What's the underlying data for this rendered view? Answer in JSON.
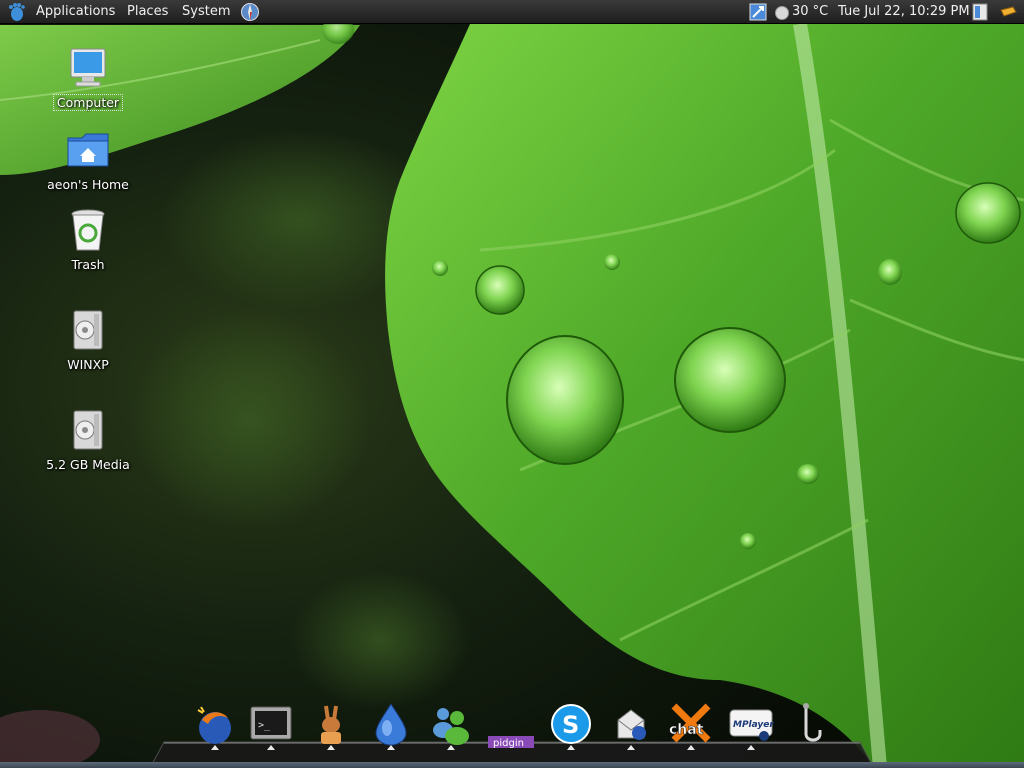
{
  "top_panel": {
    "menus": [
      "Applications",
      "Places",
      "System"
    ],
    "temperature": "30 °C",
    "datetime": "Tue Jul 22, 10:29 PM"
  },
  "desktop_icons": [
    {
      "label": "Computer",
      "icon": "computer-icon"
    },
    {
      "label": "aeon's Home",
      "icon": "home-folder-icon"
    },
    {
      "label": "Trash",
      "icon": "trash-icon"
    },
    {
      "label": "WINXP",
      "icon": "drive-icon"
    },
    {
      "label": "5.2 GB Media",
      "icon": "drive-icon"
    }
  ],
  "dock": {
    "items": [
      {
        "name": "firefox-icon"
      },
      {
        "name": "terminal-icon"
      },
      {
        "name": "amule-icon"
      },
      {
        "name": "deluge-icon"
      },
      {
        "name": "messenger-icon"
      },
      {
        "name": "pidgin-icon",
        "text": "pidgin"
      },
      {
        "name": "skype-icon"
      },
      {
        "name": "email-icon"
      },
      {
        "name": "xchat-icon",
        "text": "chat"
      },
      {
        "name": "mplayer-icon",
        "text": "MPlayer"
      },
      {
        "name": "audio-jack-icon"
      }
    ]
  },
  "colors": {
    "panel": "#2a2a2a",
    "leaf": "#5db832",
    "dark_bg": "#0d1a0a"
  }
}
